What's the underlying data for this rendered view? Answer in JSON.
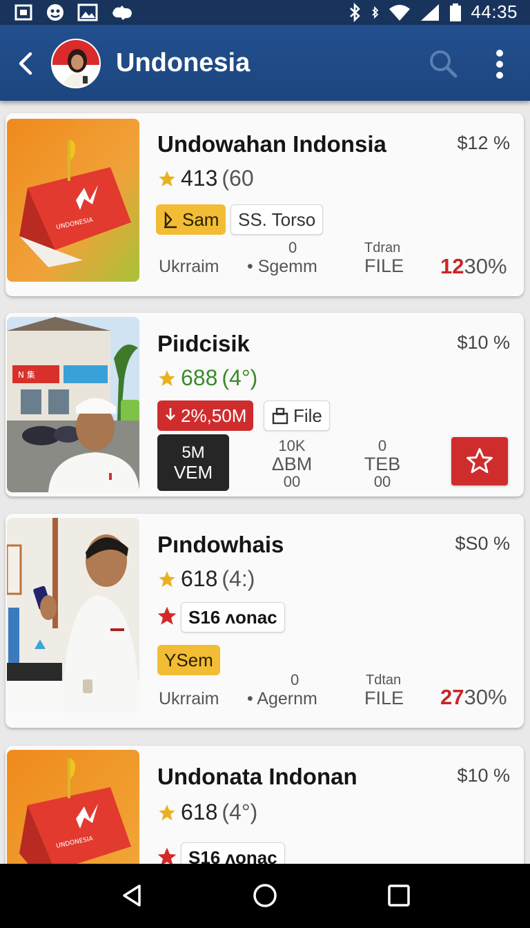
{
  "status_bar": {
    "time": "44:35"
  },
  "app_bar": {
    "title": "Undonesia"
  },
  "icons": {
    "back": "arrow-left-icon",
    "search": "search-icon",
    "more": "more-vert-icon",
    "star": "star-icon"
  },
  "colors": {
    "primary": "#1d467f",
    "accent_red": "#cf2d2d",
    "chip_yellow": "#f2bd34",
    "rating_green": "#3b8a2a"
  },
  "cards": [
    {
      "title": "Undowahan Indonsia",
      "price": "$12 %",
      "rating": "413",
      "rating_count": "(60",
      "chip1": "Sam",
      "chip2": "SS. Torso",
      "meta_left": "Ukrraim",
      "meta_mid_top": "0",
      "meta_mid": "• Sgemm",
      "meta_right_top": "Tdran",
      "meta_right": "FILE",
      "pct_red": "12",
      "pct_rest": "30%"
    },
    {
      "title": "Piıdcisik",
      "price": "$10 %",
      "rating": "688",
      "rating_count": "(4°)",
      "chip1": "2%,50M",
      "chip2": "File",
      "chip3_line1": "5M",
      "chip3_line2": "VEM",
      "stat1_l1": "10K",
      "stat1_l2": "ΔBM",
      "stat1_l3": "00",
      "stat2_l1": "0",
      "stat2_l2": "TEB",
      "stat2_l3": "00"
    },
    {
      "title": "Pındowhais",
      "price": "$S0 %",
      "rating": "618",
      "rating_count": "(4:)",
      "chip1": "S16 ʌonac",
      "chip2": "YSem",
      "meta_left": "Ukrraim",
      "meta_mid_top": "0",
      "meta_mid": "• Agernm",
      "meta_right_top": "Tdtan",
      "meta_right": "FILE",
      "pct_red": "27",
      "pct_rest": "30%"
    },
    {
      "title": "Undonata Indonan",
      "price": "$10 %",
      "rating": "618",
      "rating_count": "(4°)",
      "chip1": "S16 ʌonac"
    }
  ]
}
